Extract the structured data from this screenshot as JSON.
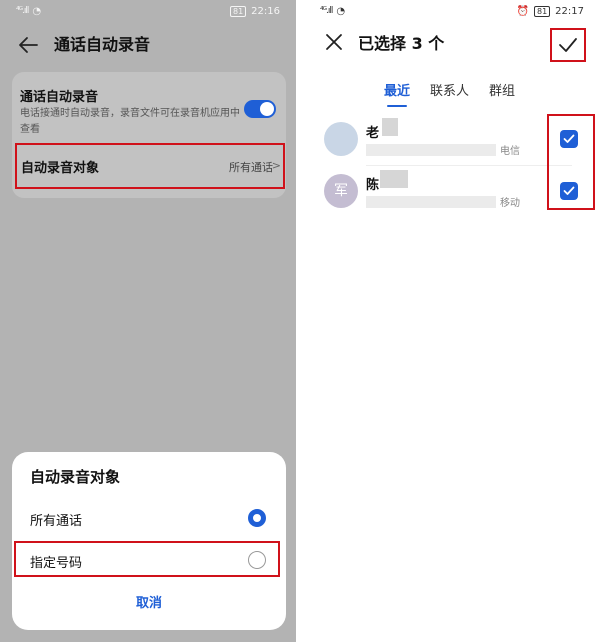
{
  "left": {
    "status": {
      "signal": "⁴ᴳ.ıll",
      "wifi": "◔",
      "battery": "81",
      "time": "22:16"
    },
    "header": {
      "title": "通话自动录音"
    },
    "setting": {
      "title": "通话自动录音",
      "description": "电话接通时自动录音，录音文件可在录音机应用中查看",
      "enabled": true
    },
    "target_row": {
      "label": "自动录音对象",
      "value": "所有通话"
    },
    "sheet": {
      "title": "自动录音对象",
      "options": [
        {
          "label": "所有通话",
          "selected": true
        },
        {
          "label": "指定号码",
          "selected": false
        }
      ],
      "cancel_label": "取消"
    }
  },
  "right": {
    "status": {
      "signal": "⁴ᴳ.ıll",
      "wifi": "◔",
      "battery": "81",
      "time": "22:17"
    },
    "header": {
      "title": "已选择 3 个"
    },
    "tabs": [
      {
        "label": "最近",
        "active": true
      },
      {
        "label": "联系人",
        "active": false
      },
      {
        "label": "群组",
        "active": false
      }
    ],
    "contacts": [
      {
        "name": "老",
        "avatar_text": "",
        "carrier": "电信",
        "checked": true
      },
      {
        "name": "陈",
        "avatar_text": "军",
        "carrier": "移动",
        "checked": true
      }
    ]
  },
  "colors": {
    "accent": "#1f5fd6",
    "highlight": "#d0111a"
  }
}
